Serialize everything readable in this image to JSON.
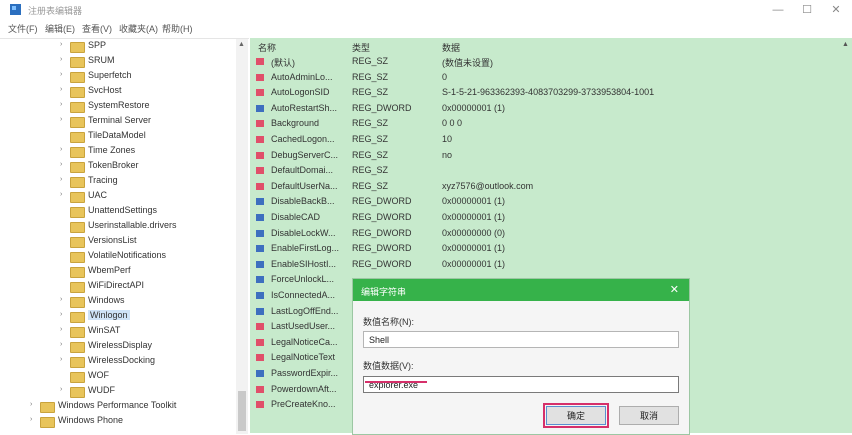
{
  "window": {
    "title": "注册表编辑器",
    "controls": [
      "—",
      "☐",
      "✕"
    ]
  },
  "menu": [
    "文件(F)",
    "编辑(E)",
    "查看(V)",
    "收藏夹(A)",
    "帮助(H)"
  ],
  "tree": {
    "items": [
      {
        "label": "SPP",
        "expandable": true
      },
      {
        "label": "SRUM",
        "expandable": true
      },
      {
        "label": "Superfetch",
        "expandable": true
      },
      {
        "label": "SvcHost",
        "expandable": true
      },
      {
        "label": "SystemRestore",
        "expandable": true
      },
      {
        "label": "Terminal Server",
        "expandable": true
      },
      {
        "label": "TileDataModel",
        "expandable": false
      },
      {
        "label": "Time Zones",
        "expandable": true
      },
      {
        "label": "TokenBroker",
        "expandable": true
      },
      {
        "label": "Tracing",
        "expandable": true
      },
      {
        "label": "UAC",
        "expandable": true
      },
      {
        "label": "UnattendSettings",
        "expandable": false
      },
      {
        "label": "Userinstallable.drivers",
        "expandable": false
      },
      {
        "label": "VersionsList",
        "expandable": false
      },
      {
        "label": "VolatileNotifications",
        "expandable": false
      },
      {
        "label": "WbemPerf",
        "expandable": false
      },
      {
        "label": "WiFiDirectAPI",
        "expandable": false
      },
      {
        "label": "Windows",
        "expandable": true
      },
      {
        "label": "Winlogon",
        "expandable": true,
        "selected": true
      },
      {
        "label": "WinSAT",
        "expandable": true
      },
      {
        "label": "WirelessDisplay",
        "expandable": true
      },
      {
        "label": "WirelessDocking",
        "expandable": true
      },
      {
        "label": "WOF",
        "expandable": false
      },
      {
        "label": "WUDF",
        "expandable": true
      },
      {
        "label": "Windows Performance Toolkit",
        "expandable": true
      },
      {
        "label": "Windows Phone",
        "expandable": true
      }
    ]
  },
  "values": {
    "columns": [
      "名称",
      "类型",
      "数据"
    ],
    "rows": [
      {
        "name": "(默认)",
        "type": "REG_SZ",
        "data": "(数值未设置)",
        "kind": "sz"
      },
      {
        "name": "AutoAdminLo...",
        "type": "REG_SZ",
        "data": "0",
        "kind": "sz"
      },
      {
        "name": "AutoLogonSID",
        "type": "REG_SZ",
        "data": "S-1-5-21-963362393-4083703299-3733953804-1001",
        "kind": "sz"
      },
      {
        "name": "AutoRestartSh...",
        "type": "REG_DWORD",
        "data": "0x00000001 (1)",
        "kind": "dw"
      },
      {
        "name": "Background",
        "type": "REG_SZ",
        "data": "0 0 0",
        "kind": "sz"
      },
      {
        "name": "CachedLogon...",
        "type": "REG_SZ",
        "data": "10",
        "kind": "sz"
      },
      {
        "name": "DebugServerC...",
        "type": "REG_SZ",
        "data": "no",
        "kind": "sz"
      },
      {
        "name": "DefaultDomai...",
        "type": "REG_SZ",
        "data": "",
        "kind": "sz"
      },
      {
        "name": "DefaultUserNa...",
        "type": "REG_SZ",
        "data": "xyz7576@outlook.com",
        "kind": "sz"
      },
      {
        "name": "DisableBackB...",
        "type": "REG_DWORD",
        "data": "0x00000001 (1)",
        "kind": "dw"
      },
      {
        "name": "DisableCAD",
        "type": "REG_DWORD",
        "data": "0x00000001 (1)",
        "kind": "dw"
      },
      {
        "name": "DisableLockW...",
        "type": "REG_DWORD",
        "data": "0x00000000 (0)",
        "kind": "dw"
      },
      {
        "name": "EnableFirstLog...",
        "type": "REG_DWORD",
        "data": "0x00000001 (1)",
        "kind": "dw"
      },
      {
        "name": "EnableSIHostI...",
        "type": "REG_DWORD",
        "data": "0x00000001 (1)",
        "kind": "dw"
      },
      {
        "name": "ForceUnlockL...",
        "type": "",
        "data": "",
        "kind": "dw"
      },
      {
        "name": "IsConnectedA...",
        "type": "",
        "data": "",
        "kind": "dw"
      },
      {
        "name": "LastLogOffEnd...",
        "type": "",
        "data": "",
        "kind": "dw"
      },
      {
        "name": "LastUsedUser...",
        "type": "",
        "data": "",
        "kind": "sz"
      },
      {
        "name": "LegalNoticeCa...",
        "type": "",
        "data": "",
        "kind": "sz"
      },
      {
        "name": "LegalNoticeText",
        "type": "",
        "data": "",
        "kind": "sz"
      },
      {
        "name": "PasswordExpir...",
        "type": "",
        "data": "",
        "kind": "dw"
      },
      {
        "name": "PowerdownAft...",
        "type": "",
        "data": "",
        "kind": "sz"
      },
      {
        "name": "PreCreateKno...",
        "type": "",
        "data": "",
        "kind": "sz"
      }
    ]
  },
  "dialog": {
    "title": "编辑字符串",
    "name_label": "数值名称(N):",
    "name_value": "Shell",
    "data_label": "数值数据(V):",
    "data_value": "explorer.exe",
    "ok_label": "确定",
    "cancel_label": "取消",
    "accent_color": "#36b24a",
    "highlight_color": "#d6306a"
  }
}
